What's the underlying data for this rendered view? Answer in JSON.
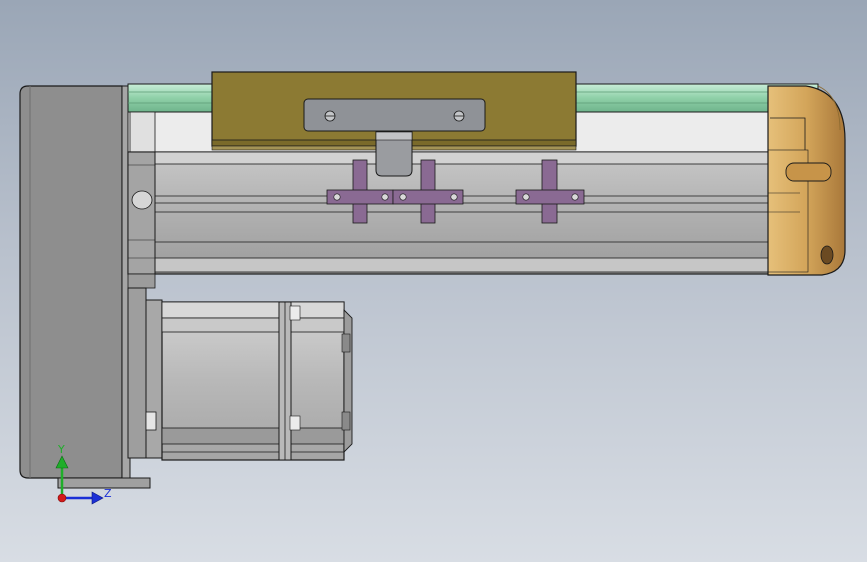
{
  "viewport": {
    "background_top": "#9aa6b6",
    "background_bottom": "#d8dde4"
  },
  "triad": {
    "y_label": "Y",
    "z_label": "Z",
    "y_color": "#1fae2a",
    "z_color": "#1b2fd6",
    "origin_color": "#d41a1a"
  },
  "colors": {
    "end_plate": "#8e8e8e",
    "profile_body": "#b2b2b2",
    "profile_light": "#d6d6d6",
    "guide_rail": "#9fd8b5",
    "carriage": "#8c7a33",
    "clamp_plate": "#8f9297",
    "end_cap": "#d3a55a",
    "bracket": "#8a6a93",
    "motor": "#bdbdbd",
    "outline": "#1a1a1a"
  }
}
